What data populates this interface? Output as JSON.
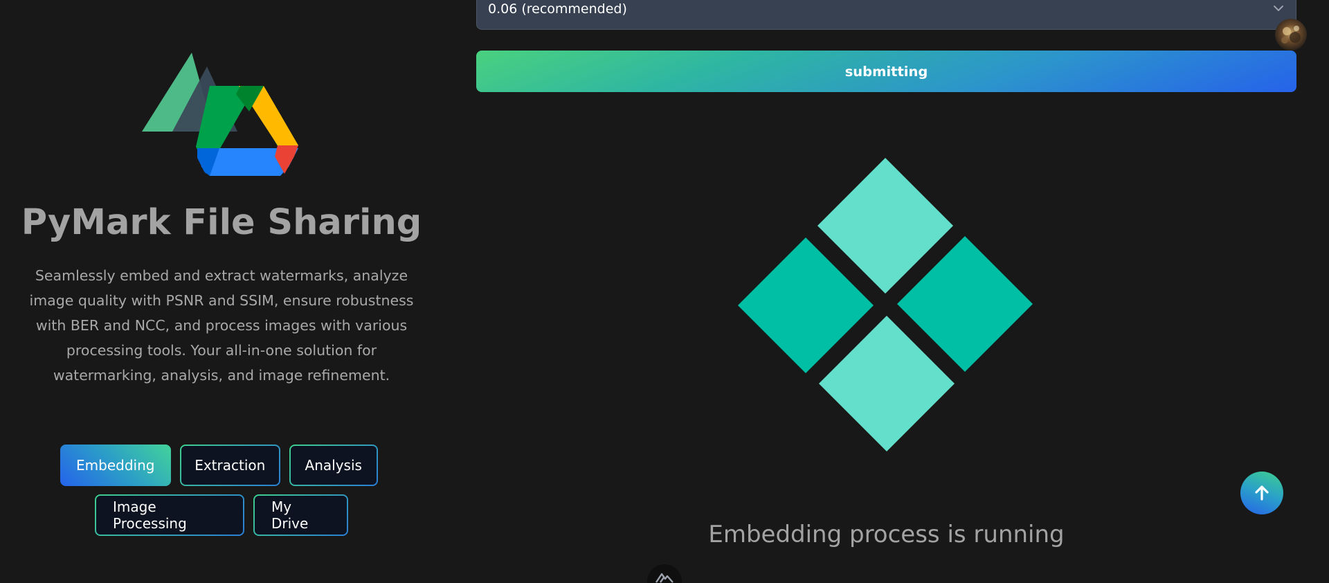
{
  "app": {
    "title": "PyMark File Sharing",
    "description": "Seamlessly embed and extract watermarks, analyze image quality with PSNR and SSIM, ensure robustness with BER and NCC, and process images with various processing tools. Your all-in-one solution for watermarking, analysis, and image refinement."
  },
  "nav": {
    "embedding": "Embedding",
    "extraction": "Extraction",
    "analysis": "Analysis",
    "image_processing": "Image Processing",
    "my_drive": "My Drive",
    "active": "Embedding"
  },
  "form": {
    "strength_select_value": "0.06 (recommended)",
    "submit_label": "submitting"
  },
  "status": {
    "running_text": "Embedding process is running"
  },
  "icons": {
    "logo": "pymark-drive-logo",
    "chevron": "chevron-down-icon",
    "scroll_top": "arrow-up-icon",
    "avatar": "user-avatar",
    "bottom": "mountain-logo-icon",
    "loader": "diamond-loader-icon"
  },
  "colors": {
    "background": "#181818",
    "accent_teal": "#00bfa5",
    "accent_teal_light": "#64dfcb",
    "accent_blue": "#2563eb",
    "accent_green": "#3ecf8e",
    "select_bg": "#374151",
    "text_muted": "#a3a3a3"
  }
}
